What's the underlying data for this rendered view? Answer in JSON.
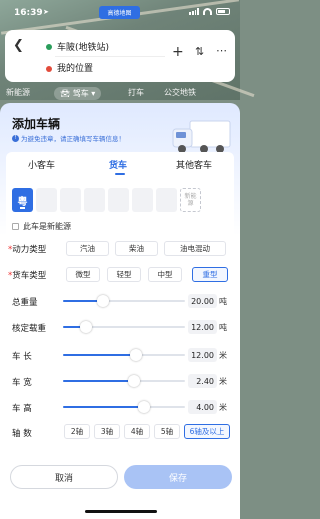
{
  "status_bar": {
    "time": "16:39",
    "app_badge": "高德地图"
  },
  "route": {
    "start": "车陂(地铁站)",
    "end": "我的位置"
  },
  "mode_tabs": [
    "新能源",
    "驾车",
    "打车",
    "公交地铁"
  ],
  "sheet": {
    "title": "添加车辆",
    "subtitle": "为避免违章，请正确填写车辆信息！",
    "vehicle_tabs": [
      "小客车",
      "货车",
      "其他客车"
    ],
    "active_tab": "货车"
  },
  "plate": {
    "province": "粤",
    "empty_count": 6,
    "new_energy_slot": [
      "新能",
      "源"
    ]
  },
  "new_energy_checkbox": {
    "label": "此车是新能源",
    "checked": false
  },
  "power_type": {
    "label": "动力类型",
    "options": [
      "汽油",
      "柴油",
      "油电混动"
    ],
    "selected": null
  },
  "truck_type": {
    "label": "货车类型",
    "options": [
      "微型",
      "轻型",
      "中型",
      "重型"
    ],
    "selected": "重型"
  },
  "sliders": [
    {
      "label": "总重量",
      "value": "20.00",
      "unit": "吨",
      "fraction": 0.33
    },
    {
      "label": "核定载重",
      "value": "12.00",
      "unit": "吨",
      "fraction": 0.19
    },
    {
      "label": "车 长",
      "value": "12.00",
      "unit": "米",
      "fraction": 0.6
    },
    {
      "label": "车 宽",
      "value": "2.40",
      "unit": "米",
      "fraction": 0.58
    },
    {
      "label": "车 高",
      "value": "4.00",
      "unit": "米",
      "fraction": 0.66
    }
  ],
  "axles": {
    "label": "轴 数",
    "options": [
      "2轴",
      "3轴",
      "4轴",
      "5轴",
      "6轴及以上"
    ],
    "selected": "6轴及以上"
  },
  "buttons": {
    "cancel": "取消",
    "save": "保存"
  },
  "colors": {
    "accent": "#2f6ee3",
    "save_disabled": "#a9c3f5",
    "required": "#ee3333"
  }
}
